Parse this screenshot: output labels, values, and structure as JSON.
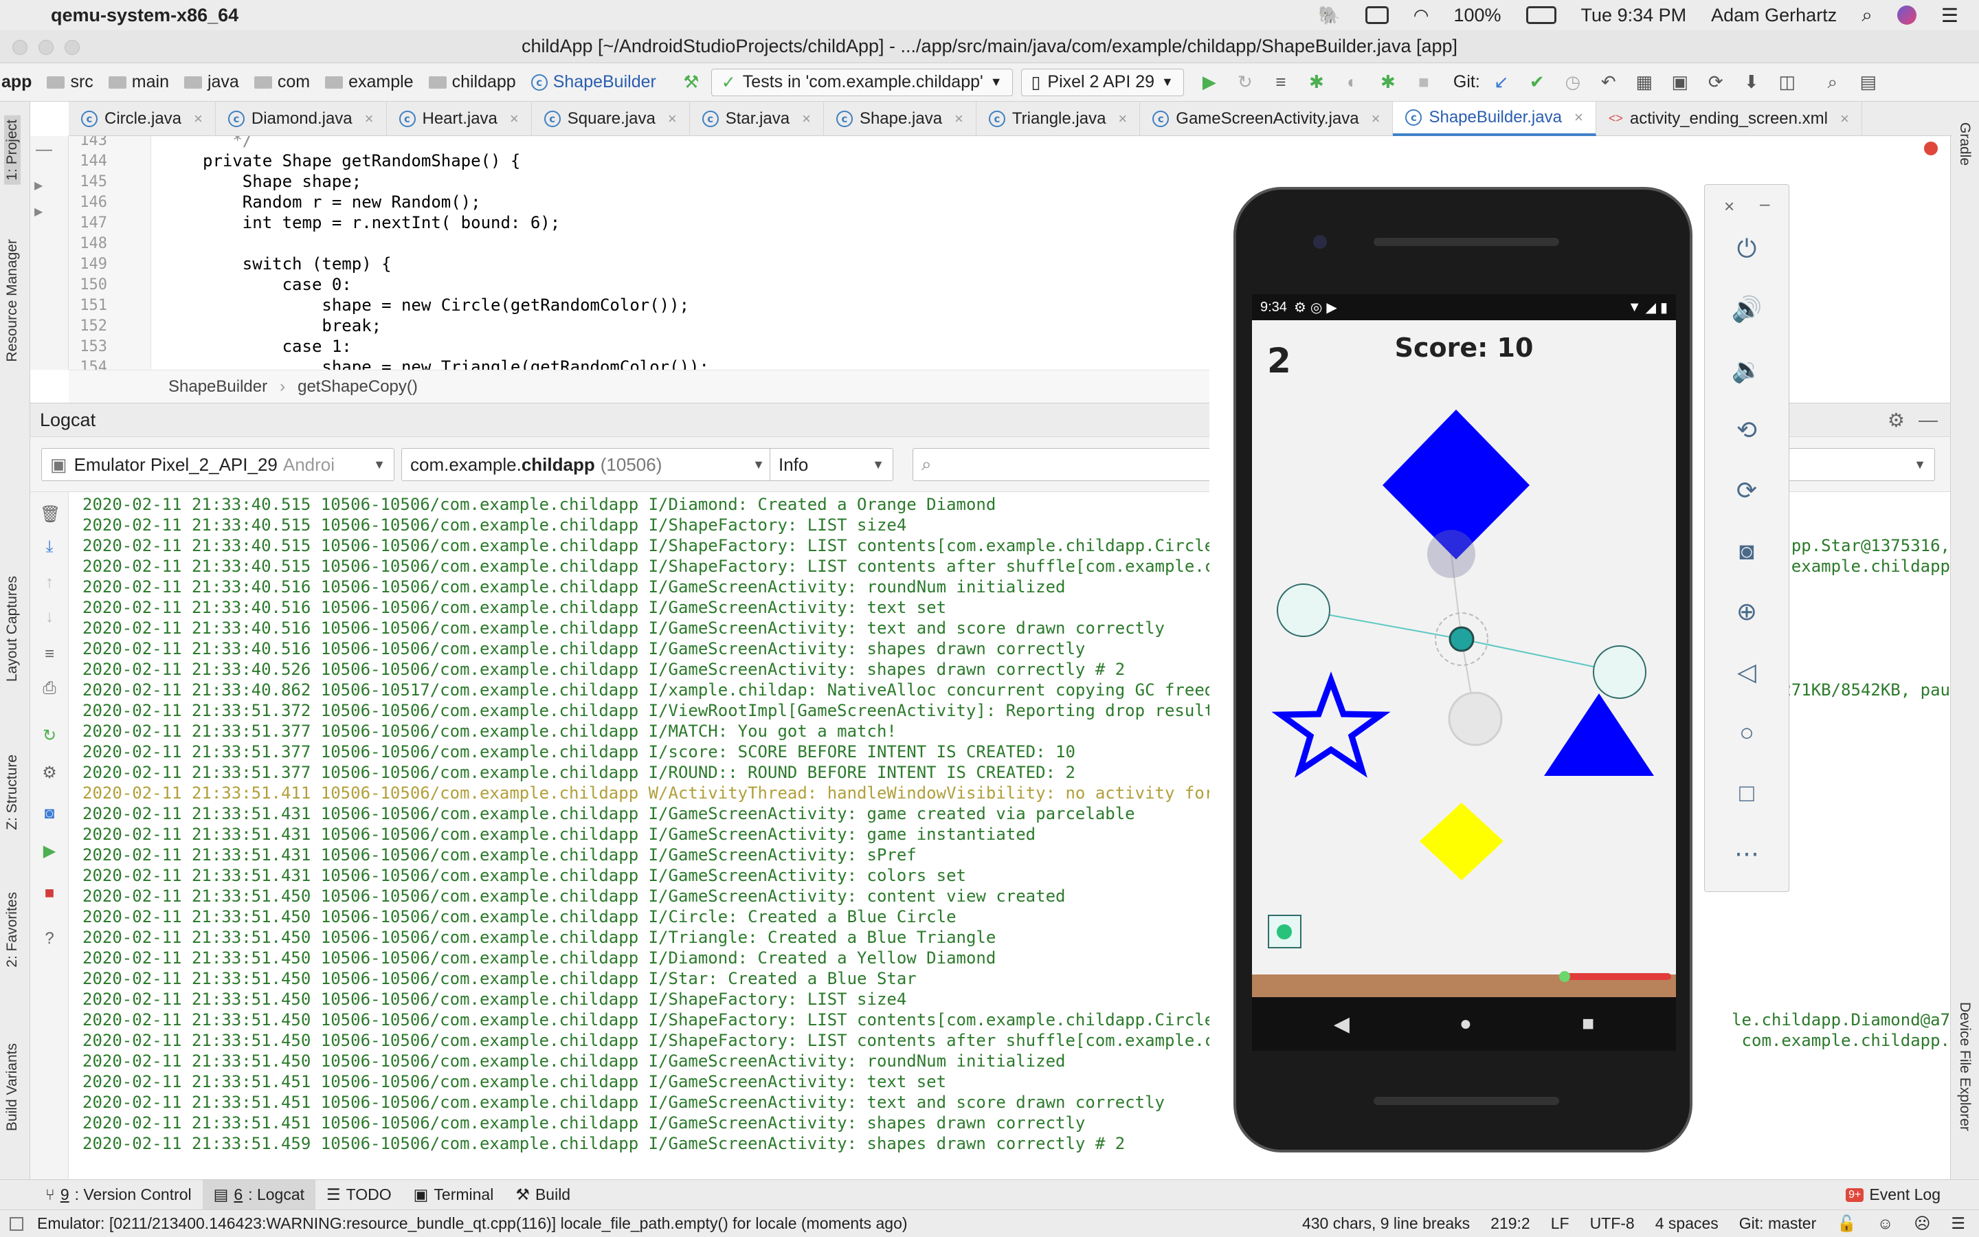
{
  "menubar": {
    "app_name": "qemu-system-x86_64",
    "battery": "100%",
    "clock": "Tue 9:34 PM",
    "user": "Adam Gerhartz"
  },
  "window": {
    "title": "childApp [~/AndroidStudioProjects/childApp] - .../app/src/main/java/com/example/childapp/ShapeBuilder.java [app]"
  },
  "nav": {
    "crumbs": [
      "app",
      "src",
      "main",
      "java",
      "com",
      "example",
      "childapp",
      "ShapeBuilder"
    ],
    "run_config": "Tests in 'com.example.childapp'",
    "device": "Pixel 2 API 29",
    "git_label": "Git:"
  },
  "tabs": [
    {
      "label": "Circle.java"
    },
    {
      "label": "Diamond.java"
    },
    {
      "label": "Heart.java"
    },
    {
      "label": "Square.java"
    },
    {
      "label": "Star.java"
    },
    {
      "label": "Shape.java"
    },
    {
      "label": "Triangle.java"
    },
    {
      "label": "GameScreenActivity.java"
    },
    {
      "label": "ShapeBuilder.java"
    },
    {
      "label": "activity_ending_screen.xml"
    }
  ],
  "code": {
    "lines": [
      {
        "n": "143",
        "text": "   */"
      },
      {
        "n": "144",
        "text": "private Shape getRandomShape() {"
      },
      {
        "n": "145",
        "text": "    Shape shape;"
      },
      {
        "n": "146",
        "text": "    Random r = new Random();"
      },
      {
        "n": "147",
        "text": "    int temp = r.nextInt( bound: 6);"
      },
      {
        "n": "148",
        "text": ""
      },
      {
        "n": "149",
        "text": "    switch (temp) {"
      },
      {
        "n": "150",
        "text": "        case 0:"
      },
      {
        "n": "151",
        "text": "            shape = new Circle(getRandomColor());"
      },
      {
        "n": "152",
        "text": "            break;"
      },
      {
        "n": "153",
        "text": "        case 1:"
      },
      {
        "n": "154",
        "text": "            shape = new Triangle(getRandomColor());"
      }
    ],
    "breadcrumb_class": "ShapeBuilder",
    "breadcrumb_method": "getShapeCopy()"
  },
  "logcat": {
    "title": "Logcat",
    "device_filter": "Emulator Pixel_2_API_29",
    "device_filter_suffix": "Androi",
    "package_prefix": "com.example.",
    "package_bold": "childapp",
    "package_pid": "(10506)",
    "level": "Info",
    "search_placeholder": "",
    "right_filter": "pplication",
    "right_filter_prefix": "S",
    "lines": [
      {
        "text": "2020-02-11 21:33:40.515 10506-10506/com.example.childapp I/Diamond: Created a Orange Diamond",
        "warn": false
      },
      {
        "text": "2020-02-11 21:33:40.515 10506-10506/com.example.childapp I/ShapeFactory: LIST size4",
        "warn": false
      },
      {
        "text": "2020-02-11 21:33:40.515 10506-10506/com.example.childapp I/ShapeFactory: LIST contents[com.example.childapp.Circle@cbad4",
        "warn": false
      },
      {
        "text": "2020-02-11 21:33:40.515 10506-10506/com.example.childapp I/ShapeFactory: LIST contents after shuffle[com.example.childap",
        "warn": false
      },
      {
        "text": "2020-02-11 21:33:40.516 10506-10506/com.example.childapp I/GameScreenActivity: roundNum initialized",
        "warn": false
      },
      {
        "text": "2020-02-11 21:33:40.516 10506-10506/com.example.childapp I/GameScreenActivity: text set",
        "warn": false
      },
      {
        "text": "2020-02-11 21:33:40.516 10506-10506/com.example.childapp I/GameScreenActivity: text and score drawn correctly",
        "warn": false
      },
      {
        "text": "2020-02-11 21:33:40.516 10506-10506/com.example.childapp I/GameScreenActivity: shapes drawn correctly",
        "warn": false
      },
      {
        "text": "2020-02-11 21:33:40.526 10506-10506/com.example.childapp I/GameScreenActivity: shapes drawn correctly # 2",
        "warn": false
      },
      {
        "text": "2020-02-11 21:33:40.862 10506-10517/com.example.childapp I/xample.childap: NativeAlloc concurrent copying GC freed 6038(",
        "warn": false
      },
      {
        "text": "2020-02-11 21:33:51.372 10506-10506/com.example.childapp I/ViewRootImpl[GameScreenActivity]: Reporting drop result: true",
        "warn": false
      },
      {
        "text": "2020-02-11 21:33:51.377 10506-10506/com.example.childapp I/MATCH: You got a match!",
        "warn": false
      },
      {
        "text": "2020-02-11 21:33:51.377 10506-10506/com.example.childapp I/score: SCORE BEFORE INTENT IS CREATED: 10",
        "warn": false
      },
      {
        "text": "2020-02-11 21:33:51.377 10506-10506/com.example.childapp I/ROUND:: ROUND BEFORE INTENT IS CREATED: 2",
        "warn": false
      },
      {
        "text": "2020-02-11 21:33:51.411 10506-10506/com.example.childapp W/ActivityThread: handleWindowVisibility: no activity for token",
        "warn": true
      },
      {
        "text": "2020-02-11 21:33:51.431 10506-10506/com.example.childapp I/GameScreenActivity: game created via parcelable",
        "warn": false
      },
      {
        "text": "2020-02-11 21:33:51.431 10506-10506/com.example.childapp I/GameScreenActivity: game instantiated",
        "warn": false
      },
      {
        "text": "2020-02-11 21:33:51.431 10506-10506/com.example.childapp I/GameScreenActivity: sPref",
        "warn": false
      },
      {
        "text": "2020-02-11 21:33:51.431 10506-10506/com.example.childapp I/GameScreenActivity: colors set",
        "warn": false
      },
      {
        "text": "2020-02-11 21:33:51.450 10506-10506/com.example.childapp I/GameScreenActivity: content view created",
        "warn": false
      },
      {
        "text": "2020-02-11 21:33:51.450 10506-10506/com.example.childapp I/Circle: Created a Blue Circle",
        "warn": false
      },
      {
        "text": "2020-02-11 21:33:51.450 10506-10506/com.example.childapp I/Triangle: Created a Blue Triangle",
        "warn": false
      },
      {
        "text": "2020-02-11 21:33:51.450 10506-10506/com.example.childapp I/Diamond: Created a Yellow Diamond",
        "warn": false
      },
      {
        "text": "2020-02-11 21:33:51.450 10506-10506/com.example.childapp I/Star: Created a Blue Star",
        "warn": false
      },
      {
        "text": "2020-02-11 21:33:51.450 10506-10506/com.example.childapp I/ShapeFactory: LIST size4",
        "warn": false
      },
      {
        "text": "2020-02-11 21:33:51.450 10506-10506/com.example.childapp I/ShapeFactory: LIST contents[com.example.childapp.Circle@492f9",
        "warn": false
      },
      {
        "text": "2020-02-11 21:33:51.450 10506-10506/com.example.childapp I/ShapeFactory: LIST contents after shuffle[com.example.childap",
        "warn": false
      },
      {
        "text": "2020-02-11 21:33:51.450 10506-10506/com.example.childapp I/GameScreenActivity: roundNum initialized",
        "warn": false
      },
      {
        "text": "2020-02-11 21:33:51.451 10506-10506/com.example.childapp I/GameScreenActivity: text set",
        "warn": false
      },
      {
        "text": "2020-02-11 21:33:51.451 10506-10506/com.example.childapp I/GameScreenActivity: text and score drawn correctly",
        "warn": false
      },
      {
        "text": "2020-02-11 21:33:51.451 10506-10506/com.example.childapp I/GameScreenActivity: shapes drawn correctly",
        "warn": false
      },
      {
        "text": "2020-02-11 21:33:51.459 10506-10506/com.example.childapp I/GameScreenActivity: shapes drawn correctly # 2",
        "warn": false
      }
    ],
    "right_fragments": [
      {
        "row": 2,
        "text": "pp.Star@1375316,"
      },
      {
        "row": 3,
        "text": ".example.childapp"
      },
      {
        "row": 9,
        "text": "271KB/8542KB, pau"
      },
      {
        "row": 25,
        "text": "xample.childapp.Diamond@a7"
      },
      {
        "row": 26,
        "text": "77e5, com.example.childapp."
      }
    ]
  },
  "bottom_tools": [
    {
      "key": "9",
      "label": ": Version Control"
    },
    {
      "key": "6",
      "label": ": Logcat"
    },
    {
      "key": "",
      "label": "TODO"
    },
    {
      "key": "",
      "label": "Terminal"
    },
    {
      "key": "",
      "label": "Build"
    }
  ],
  "event_log": {
    "badge": "9+",
    "label": "Event Log"
  },
  "status": {
    "message": "Emulator: [0211/213400.146423:WARNING:resource_bundle_qt.cpp(116)] locale_file_path.empty() for locale (moments ago)",
    "chars": "430 chars, 9 line breaks",
    "position": "219:2",
    "line_sep": "LF",
    "encoding": "UTF-8",
    "indent": "4 spaces",
    "git": "Git: master"
  },
  "side_labels": {
    "project": "1: Project",
    "resource_manager": "Resource Manager",
    "layout_captures": "Layout Captures",
    "structure": "Z: Structure",
    "favorites": "2: Favorites",
    "build_variants": "Build Variants",
    "gradle": "Gradle",
    "device_file_explorer": "Device File Explorer"
  },
  "phone": {
    "clock": "9:34",
    "round": "2",
    "score": "Score: 10",
    "colors": {
      "blue": "#0000ff",
      "yellow": "#ffff00",
      "ground": "#b8825a",
      "teal": "#20a39e"
    }
  }
}
